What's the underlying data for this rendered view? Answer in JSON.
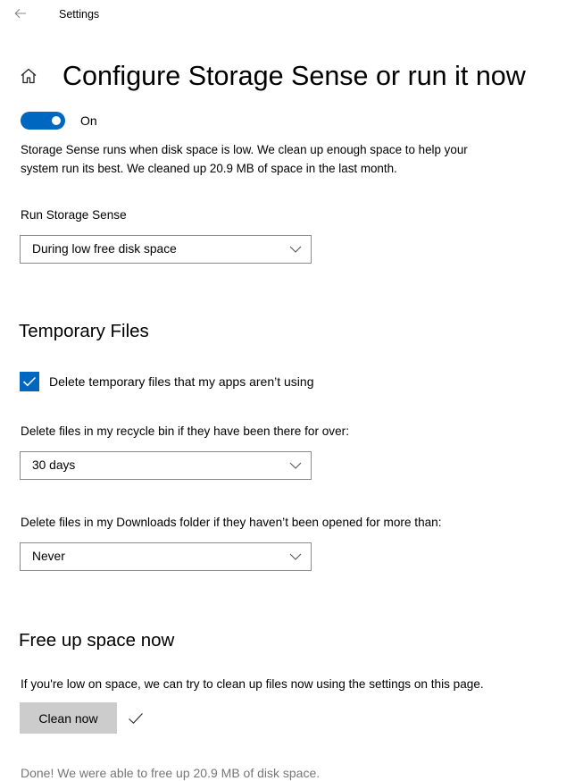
{
  "window": {
    "back_icon": "back-arrow-icon",
    "title": "Settings"
  },
  "page": {
    "home_icon": "home-icon",
    "title": "Configure Storage Sense or run it now"
  },
  "storage_sense": {
    "toggle_state": "On",
    "toggle_on": true,
    "description": "Storage Sense runs when disk space is low. We clean up enough space to help your system run its best. We cleaned up 20.9 MB of space in the last month.",
    "run_label": "Run Storage Sense",
    "run_value": "During low free disk space"
  },
  "temporary_files": {
    "heading": "Temporary Files",
    "delete_temp_label": "Delete temporary files that my apps aren’t using",
    "delete_temp_checked": true,
    "recycle_label": "Delete files in my recycle bin if they have been there for over:",
    "recycle_value": "30 days",
    "downloads_label": "Delete files in my Downloads folder if they haven’t been opened for more than:",
    "downloads_value": "Never"
  },
  "free_up": {
    "heading": "Free up space now",
    "description": "If you're low on space, we can try to clean up files now using the settings on this page.",
    "button_label": "Clean now",
    "status_icon": "checkmark-icon",
    "done_text": "Done! We were able to free up 20.9 MB of disk space."
  },
  "colors": {
    "accent": "#0067c0",
    "button_bg": "#cccccc",
    "muted_text": "#767676"
  }
}
